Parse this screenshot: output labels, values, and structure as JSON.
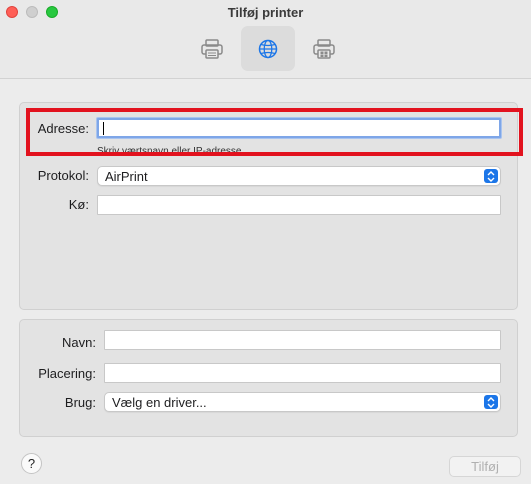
{
  "window": {
    "title": "Tilføj printer"
  },
  "toolbar": {
    "items": [
      {
        "icon": "printer-icon",
        "selected": false
      },
      {
        "icon": "globe-icon",
        "selected": true
      },
      {
        "icon": "printer-icon",
        "selected": false
      }
    ]
  },
  "form": {
    "address": {
      "label": "Adresse:",
      "value": "",
      "hint": "Skriv værtsnavn eller IP-adresse."
    },
    "protocol": {
      "label": "Protokol:",
      "value": "AirPrint"
    },
    "queue": {
      "label": "Kø:",
      "value": ""
    },
    "name": {
      "label": "Navn:",
      "value": ""
    },
    "location": {
      "label": "Placering:",
      "value": ""
    },
    "use": {
      "label": "Brug:",
      "value": "Vælg en driver..."
    }
  },
  "footer": {
    "help_label": "?",
    "add_label": "Tilføj"
  },
  "colors": {
    "accent": "#1c76e8",
    "highlight": "#e2121e"
  }
}
